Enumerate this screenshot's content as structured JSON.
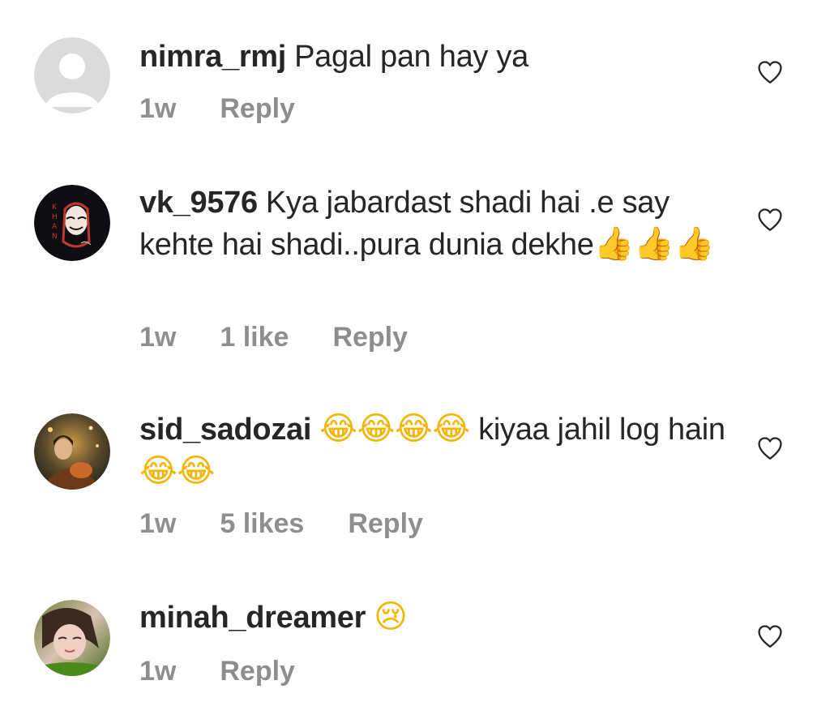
{
  "accent_color": "#262626",
  "meta_color": "#8e8e8e",
  "comments": [
    {
      "username": "nimra_rmj",
      "text": "Pagal pan hay ya",
      "time": "1w",
      "likes": "",
      "reply": "Reply",
      "avatar": "default-avatar-icon",
      "heart": "heart-outline-icon"
    },
    {
      "username": "vk_9576",
      "text": "Kya jabardast shadi hai .e say kehte hai shadi..pura dunia dekhe",
      "emojis": "👍👍👍",
      "time": "1w",
      "likes": "1 like",
      "reply": "Reply",
      "avatar": "khan-mask-avatar",
      "avatar_text": "KHAN",
      "heart": "heart-outline-icon"
    },
    {
      "username": "sid_sadozai",
      "emojis_before": "😂😂😂😂",
      "text": " kiyaa jahil log hain ",
      "emojis_after": "😂😂",
      "time": "1w",
      "likes": "5 likes",
      "reply": "Reply",
      "avatar": "photo-avatar",
      "heart": "heart-outline-icon"
    },
    {
      "username": "minah_dreamer",
      "emojis": "😢",
      "text": "",
      "time": "1w",
      "likes": "",
      "reply": "Reply",
      "avatar": "photo-avatar",
      "heart": "heart-outline-icon"
    }
  ]
}
